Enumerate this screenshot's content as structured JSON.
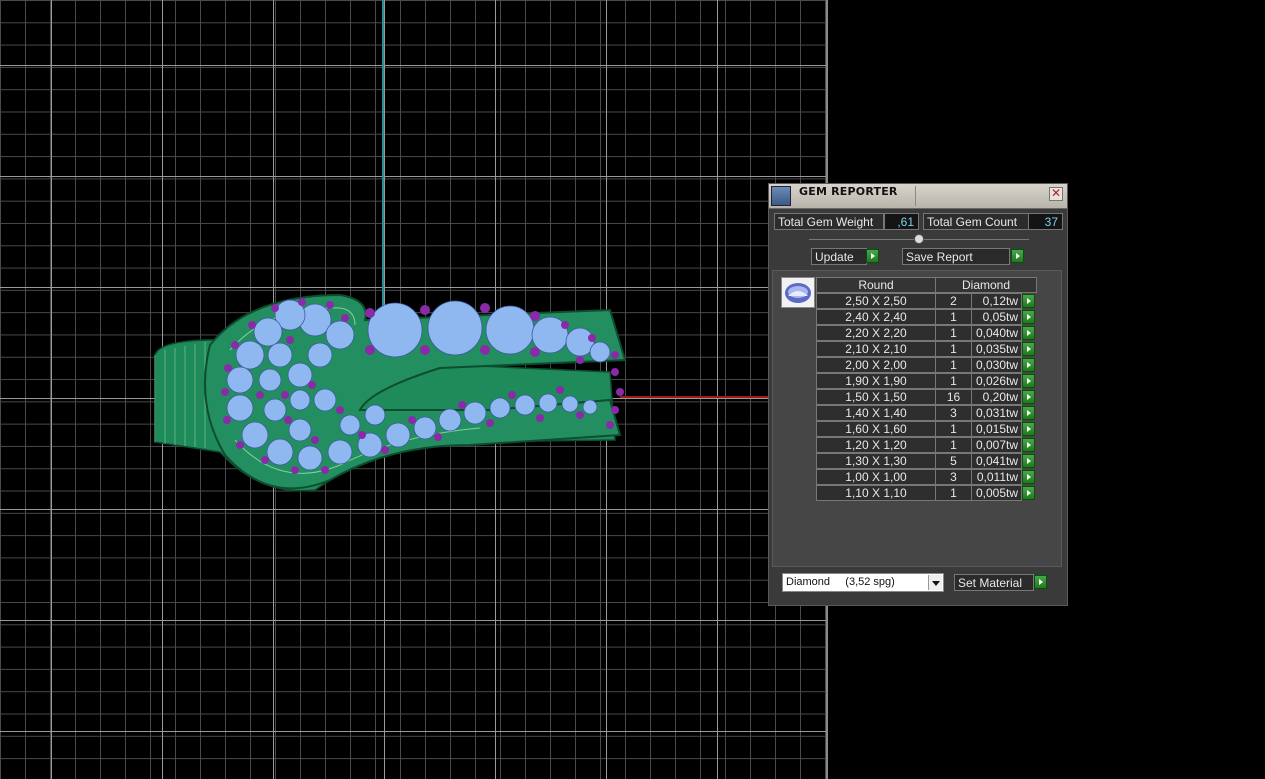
{
  "panel": {
    "title": "GEM REPORTER",
    "close_glyph": "✕",
    "total_weight_label": "Total Gem Weight",
    "total_weight_value": ",61",
    "total_count_label": "Total Gem Count",
    "total_count_value": "37",
    "update_label": "Update",
    "save_report_label": "Save Report",
    "table": {
      "header_shape": "Round",
      "header_material": "Diamond",
      "rows": [
        {
          "size": "2,50 X 2,50",
          "count": "2",
          "weight": "0,12tw"
        },
        {
          "size": "2,40 X 2,40",
          "count": "1",
          "weight": "0,05tw"
        },
        {
          "size": "2,20 X 2,20",
          "count": "1",
          "weight": "0,040tw"
        },
        {
          "size": "2,10 X 2,10",
          "count": "1",
          "weight": "0,035tw"
        },
        {
          "size": "2,00 X 2,00",
          "count": "1",
          "weight": "0,030tw"
        },
        {
          "size": "1,90 X 1,90",
          "count": "1",
          "weight": "0,026tw"
        },
        {
          "size": "1,50 X 1,50",
          "count": "16",
          "weight": "0,20tw"
        },
        {
          "size": "1,40 X 1,40",
          "count": "3",
          "weight": "0,031tw"
        },
        {
          "size": "1,60 X 1,60",
          "count": "1",
          "weight": "0,015tw"
        },
        {
          "size": "1,20 X 1,20",
          "count": "1",
          "weight": "0,007tw"
        },
        {
          "size": "1,30 X 1,30",
          "count": "5",
          "weight": "0,041tw"
        },
        {
          "size": "1,00 X 1,00",
          "count": "3",
          "weight": "0,011tw"
        },
        {
          "size": "1,10 X 1,10",
          "count": "1",
          "weight": "0,005tw"
        }
      ]
    },
    "material_select": "Diamond     (3,52 spg)",
    "set_material_label": "Set Material"
  },
  "colors": {
    "ring_body": "#1f8a5a",
    "gem": "#8fb8f0",
    "prong": "#8a2aa8",
    "value_text": "#7fd0f0",
    "go_button": "#2e8e2e"
  },
  "icons": [
    "gem-reporter-icon",
    "close-icon",
    "play-arrow-icon",
    "gem-thumbnail-icon",
    "dropdown-arrow-icon"
  ]
}
